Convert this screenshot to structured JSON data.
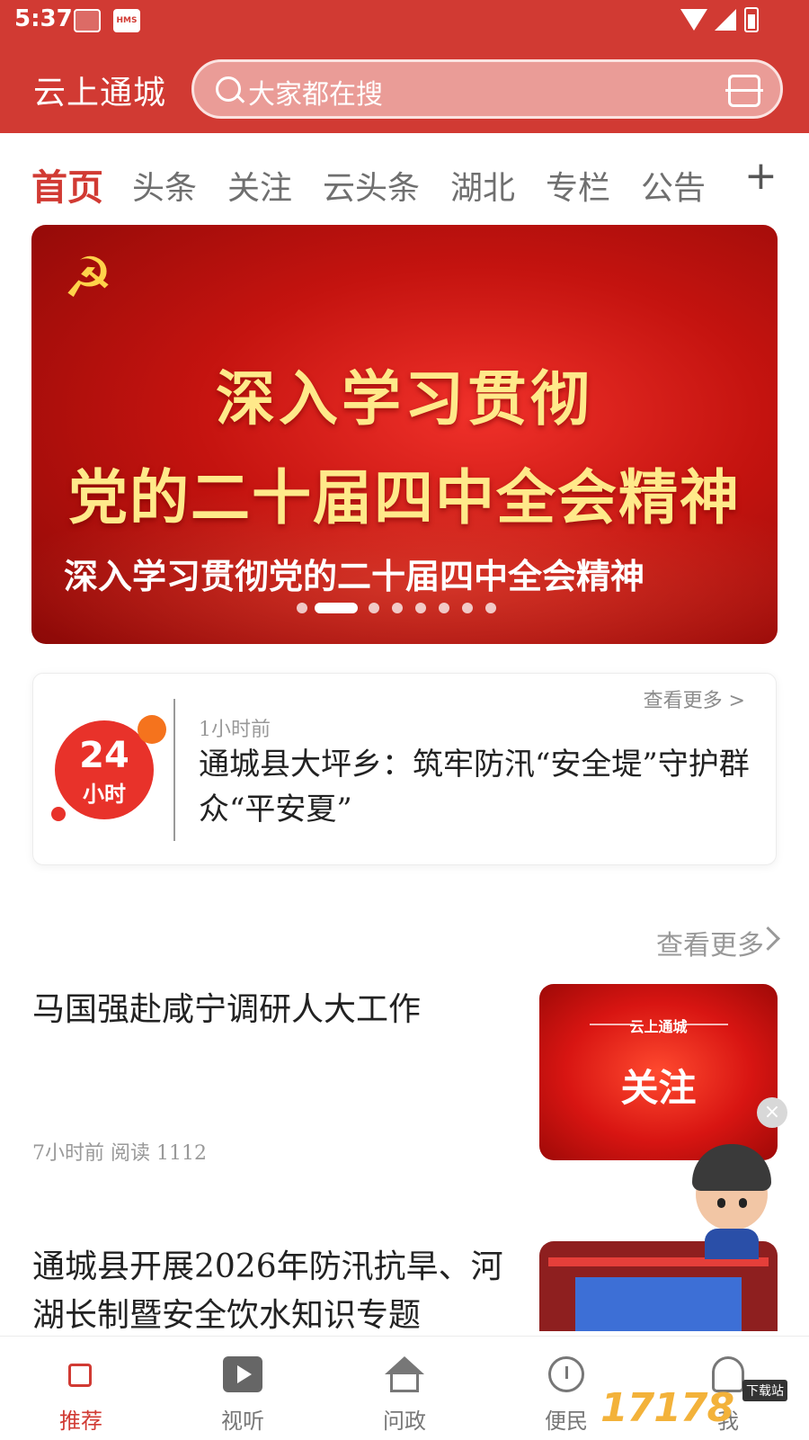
{
  "status_bar": {
    "time": "5:37",
    "icons": [
      "app-icon",
      "hms-icon",
      "wifi-icon",
      "signal-icon",
      "battery-icon"
    ],
    "hms_label": "HMS"
  },
  "header": {
    "app_title": "云上通城",
    "search_placeholder": "大家都在搜",
    "accent_color": "#d13a33"
  },
  "tabs": {
    "items": [
      "首页",
      "头条",
      "关注",
      "云头条",
      "湖北",
      "专栏",
      "公告"
    ],
    "active": "首页"
  },
  "banner": {
    "line1": "深入学习贯彻",
    "line2": "党的二十届四中全会精神",
    "caption": "深入学习贯彻党的二十届四中全会精神",
    "page_count": 9,
    "active_index": 1
  },
  "card24": {
    "badge_num": "24",
    "badge_unit": "小时",
    "more": "查看更多 >",
    "time": "1小时前",
    "headline": "通城县大坪乡：筑牢防汛“安全堤”守护群众“平安夏”"
  },
  "list": {
    "more": "查看更多",
    "items": [
      {
        "title": "马国强赴咸宁调研人大工作",
        "meta": "7小时前  阅读 1112",
        "thumb_small": "云上通城",
        "thumb_big": "关注"
      },
      {
        "title": "通城县开展2026年防汛抗旱、河湖长制暨安全饮水知识专题"
      }
    ]
  },
  "bottom_nav": {
    "items": [
      {
        "label": "推荐",
        "icon": "speaker-icon",
        "active": true
      },
      {
        "label": "视听",
        "icon": "video-icon"
      },
      {
        "label": "问政",
        "icon": "home-icon"
      },
      {
        "label": "便民",
        "icon": "clock-icon"
      },
      {
        "label": "我",
        "icon": "person-icon"
      }
    ]
  },
  "watermark": {
    "text": "17178",
    "sub": "下载站"
  }
}
